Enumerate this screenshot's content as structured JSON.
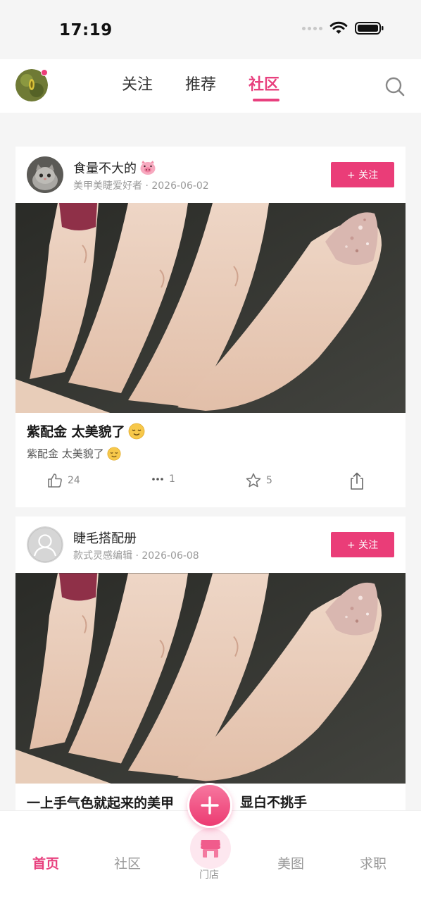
{
  "status_bar": {
    "time": "17:19"
  },
  "top_nav": {
    "tabs": [
      {
        "label": "关注",
        "active": false
      },
      {
        "label": "推荐",
        "active": false
      },
      {
        "label": "社区",
        "active": true
      }
    ],
    "search_icon": "search-icon"
  },
  "posts": [
    {
      "author": "食量不大的",
      "author_emoji": "pig-face-icon",
      "meta": "美甲美睫爱好者 · 2026-06-02",
      "follow_label": "+ 关注",
      "title": "紫配金 太美貌了",
      "desc": "紫配金 太美貌了",
      "likes": "24",
      "comments": "1",
      "favorites": "5"
    },
    {
      "author": "睫毛搭配册",
      "meta": "款式灵感编辑 · 2026-06-08",
      "follow_label": "+ 关注",
      "title_left": "一上手气色就起来的美甲",
      "title_right": "显白不挑手"
    }
  ],
  "bottom_nav": {
    "items": [
      {
        "label": "首页",
        "active": true
      },
      {
        "label": "社区",
        "active": false
      },
      {
        "label": "门店",
        "active": false
      },
      {
        "label": "美图",
        "active": false
      },
      {
        "label": "求职",
        "active": false
      }
    ]
  },
  "colors": {
    "accent": "#e8407e",
    "follow_button": "#ea3d78",
    "background": "#f5f5f5"
  }
}
